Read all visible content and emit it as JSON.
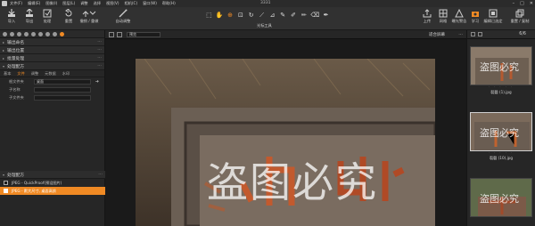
{
  "window": {
    "title": "3331"
  },
  "menu": [
    "文件(F)",
    "编辑(E)",
    "图像(I)",
    "图层(L)",
    "调整",
    "选择",
    "视图(V)",
    "相机(C)",
    "窗口(W)",
    "帮助(H)"
  ],
  "toolbar": {
    "import_label": "导入",
    "export_label": "导出",
    "process_label": "处理",
    "reset_label": "重置",
    "undo_redo_label": "撤销 / 重做",
    "auto_adjust_label": "自动调整",
    "cursor_tools_label": "光标工具",
    "right_buttons": [
      "上传",
      "网格",
      "曝光警告",
      "学习",
      "编辑已选定",
      "重置 / 复制"
    ]
  },
  "left_panel": {
    "sections_top": [
      "输出命名",
      "输出位置",
      "批量处理",
      "处理配方"
    ],
    "subtabs": [
      "基本",
      "文件",
      "调整",
      "元数据",
      "水印"
    ],
    "active_subtab": "文件",
    "form": [
      {
        "label": "根文件夹",
        "value": "桌面"
      },
      {
        "label": "子名称",
        "value": ""
      },
      {
        "label": "子文件夹",
        "value": ""
      }
    ],
    "recipe_section": "处理配方",
    "recipes": [
      {
        "label": "JPEG - QuickProof(预设图片)",
        "selected": false
      },
      {
        "label": "JPEG - 默大尺寸, 桌面高质",
        "selected": true
      }
    ]
  },
  "viewer": {
    "proof_select": "预览",
    "fit_label": "适合屏幕",
    "watermark_text": "盗图必究"
  },
  "filmstrip": {
    "count": "6/6",
    "items": [
      {
        "name": "裂磬 (1).jpg",
        "watermark": "盗图必究",
        "selected": false
      },
      {
        "name": "裂磬 (10).jpg",
        "watermark": "盗图必究",
        "selected": true
      },
      {
        "name": "",
        "watermark": "盗图必究",
        "selected": false
      }
    ]
  },
  "colors": {
    "accent": "#f08a24",
    "panel": "#262626",
    "toolbar": "#313131"
  }
}
